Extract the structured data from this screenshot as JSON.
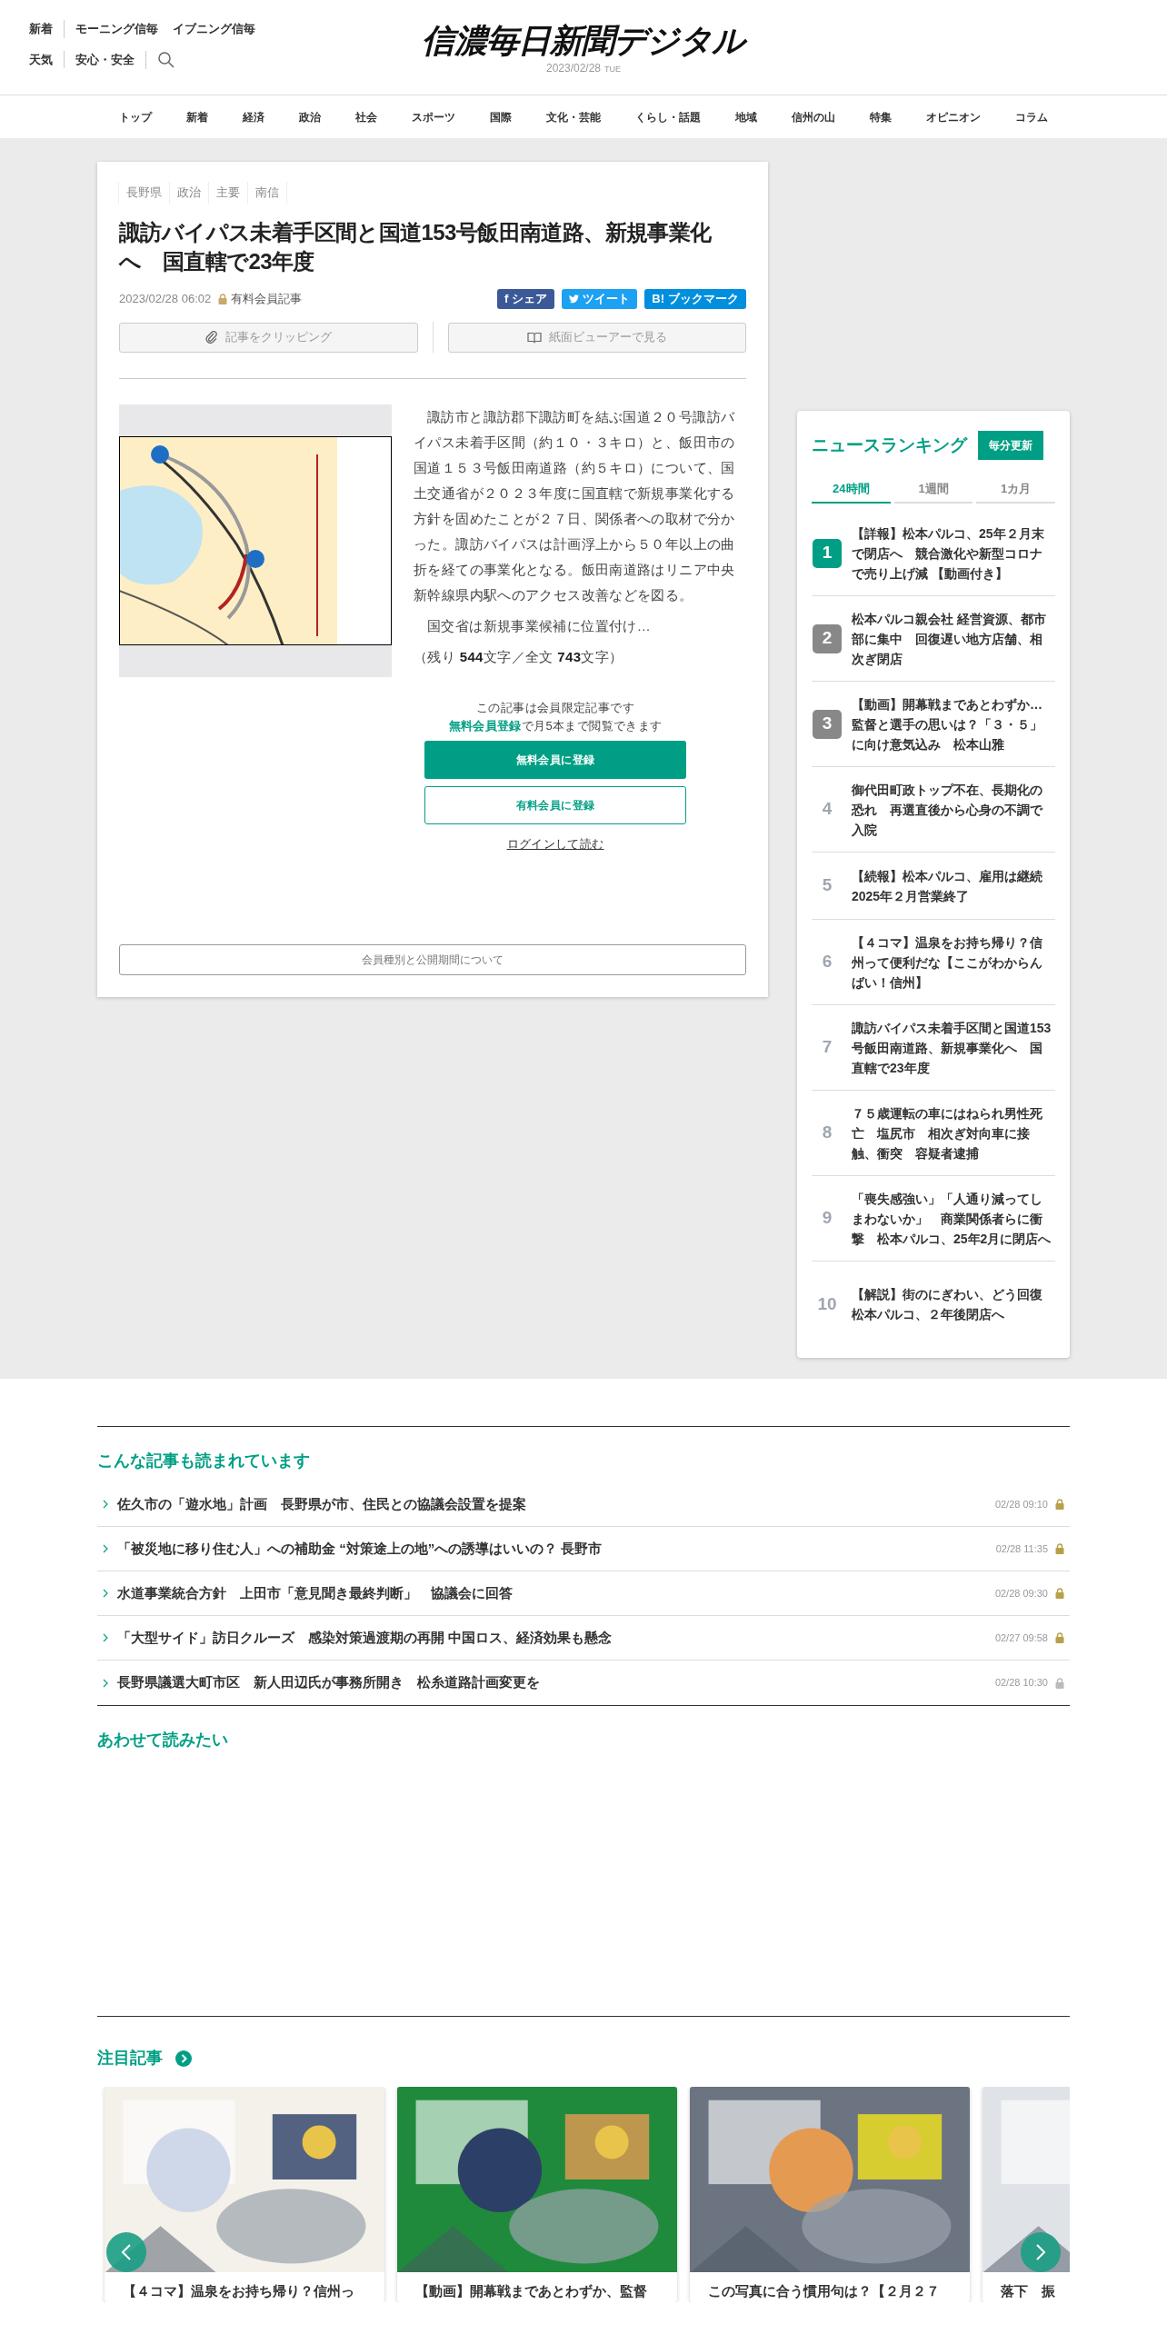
{
  "header": {
    "left_top": [
      "新着",
      "モーニング信毎",
      "イブニング信毎"
    ],
    "left_bottom": [
      "天気",
      "安心・安全"
    ],
    "logo": "信濃毎日新聞デジタル",
    "date": "2023/02/28",
    "weekday": "TUE"
  },
  "nav": [
    "トップ",
    "新着",
    "経済",
    "政治",
    "社会",
    "スポーツ",
    "国際",
    "文化・芸能",
    "くらし・話題",
    "地域",
    "信州の山",
    "特集",
    "オピニオン",
    "コラム"
  ],
  "article": {
    "tags": [
      "長野県",
      "政治",
      "主要",
      "南信"
    ],
    "title": "諏訪バイパス未着手区間と国道153号飯田南道路、新規事業化へ　国直轄で23年度",
    "datetime": "2023/02/28 06:02",
    "member_label": "有料会員記事",
    "share": [
      {
        "kind": "facebook",
        "icon_text": "f",
        "label": "シェア"
      },
      {
        "kind": "twitter",
        "label": "ツイート"
      },
      {
        "kind": "hatena",
        "icon_text": "B!",
        "label": "ブックマーク"
      }
    ],
    "tools": [
      {
        "kind": "clip",
        "label": "記事をクリッピング"
      },
      {
        "kind": "viewer",
        "label": "紙面ビューアーで見る"
      }
    ],
    "figure": {
      "kind": "picture"
    },
    "paragraphs": [
      "諏訪市と諏訪郡下諏訪町を結ぶ国道２０号諏訪バイパス未着手区間（約１０・３キロ）と、飯田市の国道１５３号飯田南道路（約５キロ）について、国土交通省が２０２３年度に国直轄で新規事業化する方針を固めたことが２７日、関係者への取材で分かった。諏訪バイパスは計画浮上から５０年以上の曲折を経ての事業化となる。飯田南道路はリニア中央新幹線県内駅へのアクセス改善などを図る。",
      "国交省は新規事業候補に位置付け…"
    ],
    "remaining": "（残り **544**文字／全文 **743**文字）",
    "paywall": {
      "lines": [
        "この記事は会員限定記事です",
        "**無料会員登録**で月5本まで閲覧できます"
      ],
      "primary": "無料会員に登録",
      "secondary": "有料会員に登録",
      "login": "ログインして読む"
    },
    "about": "会員種別と公開期間について"
  },
  "ranking": {
    "title": "ニュースランキング",
    "badge": "毎分更新",
    "tabs": [
      {
        "label": "24時間",
        "selected": true
      },
      {
        "label": "1週間",
        "selected": false
      },
      {
        "label": "1カ月",
        "selected": false
      }
    ],
    "items": [
      {
        "rank": "1",
        "kind": "badge",
        "color": "#009f85",
        "title": "【詳報】松本パルコ、25年２月末で閉店へ　競合激化や新型コロナで売り上げ減 【動画付き】"
      },
      {
        "rank": "2",
        "kind": "badge",
        "color": "#888888",
        "title": "松本パルコ親会社 経営資源、都市部に集中　回復遅い地方店舗、相次ぎ閉店"
      },
      {
        "rank": "3",
        "kind": "badge",
        "color": "#888888",
        "title": "【動画】開幕戦まであとわずか…監督と選手の思いは？「３・５」に向け意気込み　松本山雅"
      },
      {
        "rank": "4",
        "kind": "plain",
        "title": "御代田町政トップ不在、長期化の恐れ　再選直後から心身の不調で入院"
      },
      {
        "rank": "5",
        "kind": "plain",
        "title": "【続報】松本パルコ、雇用は継続 2025年２月営業終了"
      },
      {
        "rank": "6",
        "kind": "plain",
        "title": "【４コマ】温泉をお持ち帰り？信州って便利だな【ここがわからんばい！信州】"
      },
      {
        "rank": "7",
        "kind": "plain",
        "title": "諏訪バイパス未着手区間と国道153号飯田南道路、新規事業化へ　国直轄で23年度"
      },
      {
        "rank": "8",
        "kind": "plain",
        "title": "７５歳運転の車にはねられ男性死亡　塩尻市　相次ぎ対向車に接触、衝突　容疑者逮捕"
      },
      {
        "rank": "9",
        "kind": "plain",
        "title": "「喪失感強い」「人通り減ってしまわないか」　商業関係者らに衝撃　松本パルコ、25年2月に閉店へ"
      },
      {
        "rank": "10",
        "kind": "plain",
        "title": "【解説】街のにぎわい、どう回復松本パルコ、２年後閉店へ"
      }
    ]
  },
  "popular": {
    "title": "こんな記事も読まれています",
    "items": [
      {
        "title": "佐久市の「遊水地」計画　長野県が市、住民との協議会設置を提案",
        "time": "02/28 09:10",
        "color": "#b8a04a"
      },
      {
        "title": "「被災地に移り住む人」への補助金 “対策途上の地”への誘導はいいの？ 長野市",
        "time": "02/28 11:35",
        "color": "#b8a04a"
      },
      {
        "title": "水道事業統合方針　上田市「意見聞き最終判断」　協議会に回答",
        "time": "02/28 09:30",
        "color": "#b8a04a"
      },
      {
        "title": "「大型サイド」訪日クルーズ　感染対策過渡期の再開 中国ロス、経済効果も懸念",
        "time": "02/27 09:58",
        "color": "#b8a04a"
      },
      {
        "title": "長野県議選大町市区　新人田辺氏が事務所開き　松糸道路計画変更を",
        "time": "02/28 10:30",
        "color": "#bbbbbb"
      }
    ]
  },
  "related": {
    "title": "あわせて読みたい"
  },
  "featured": {
    "title": "注目記事",
    "cards": [
      {
        "title": "【４コマ】温泉をお持ち帰り？信州っ",
        "kind": "picture"
      },
      {
        "title": "【動画】開幕戦まであとわずか、監督",
        "kind": "picture"
      },
      {
        "title": "この写真に合う慣用句は？【２月２７",
        "kind": "picture"
      },
      {
        "title": "落下　振",
        "kind": "picture"
      }
    ]
  }
}
